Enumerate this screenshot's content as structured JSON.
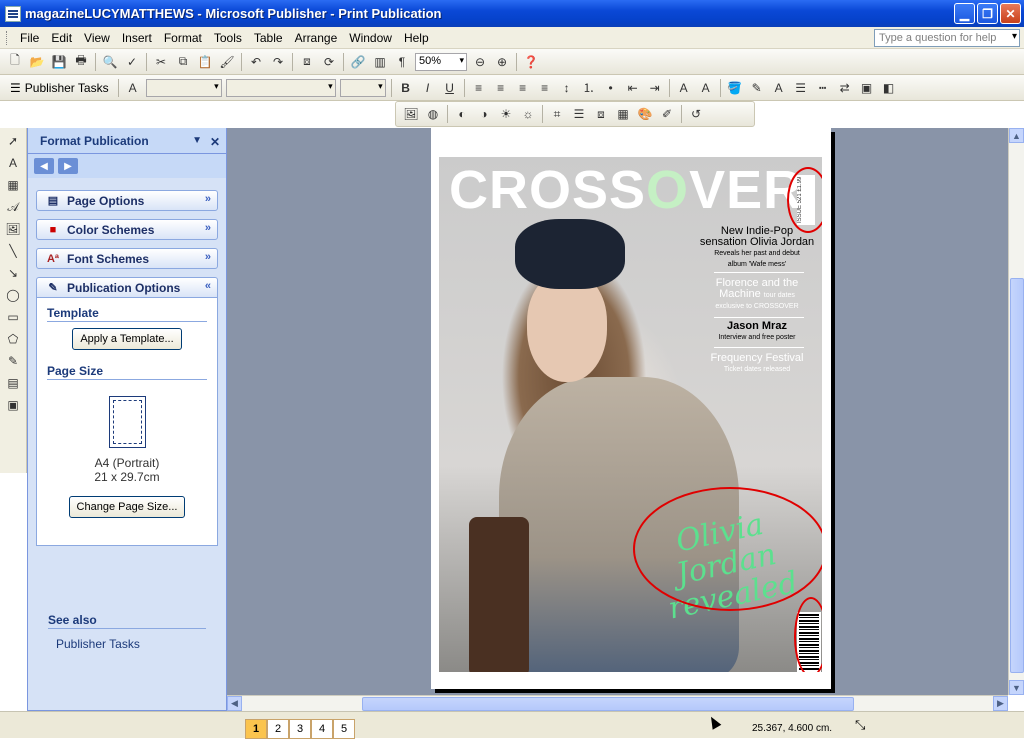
{
  "window": {
    "title": "magazineLUCYMATTHEWS - Microsoft Publisher - Print Publication"
  },
  "menu": [
    "File",
    "Edit",
    "View",
    "Insert",
    "Format",
    "Tools",
    "Table",
    "Arrange",
    "Window",
    "Help"
  ],
  "help_placeholder": "Type a question for help",
  "toolbar": {
    "zoom": "50%",
    "publisher_tasks": "Publisher Tasks"
  },
  "taskpane": {
    "title": "Format Publication",
    "sections": [
      "Page Options",
      "Color Schemes",
      "Font Schemes",
      "Publication Options"
    ],
    "template_heading": "Template",
    "apply_template": "Apply a Template...",
    "page_size_heading": "Page Size",
    "size_name": "A4 (Portrait)",
    "size_dims": "21 x 29.7cm",
    "change_size": "Change Page Size...",
    "see_also": "See also",
    "see_also_link": "Publisher Tasks"
  },
  "cover": {
    "masthead_a": "CROSS",
    "masthead_o": "O",
    "masthead_b": "VER",
    "price_box": "ISSUE 521 £1.99",
    "line1": "New Indie-Pop",
    "line2": "sensation Olivia Jordan",
    "line3": "Reveals her past and debut",
    "line4": "album 'Wafe mess'",
    "line5": "Florence and the",
    "line6": "Machine",
    "line6b": "tour dates",
    "line7": "exclusive to CROSSOVER",
    "line8": "Jason Mraz",
    "line9": "Interview and free poster",
    "line10": "Frequency Festival",
    "line11": "Ticket dates released",
    "script": "Olivia Jordan revealed"
  },
  "status": {
    "pages": [
      "1",
      "2",
      "3",
      "4",
      "5"
    ],
    "active_page": "1",
    "coords": "25.367, 4.600 cm."
  }
}
